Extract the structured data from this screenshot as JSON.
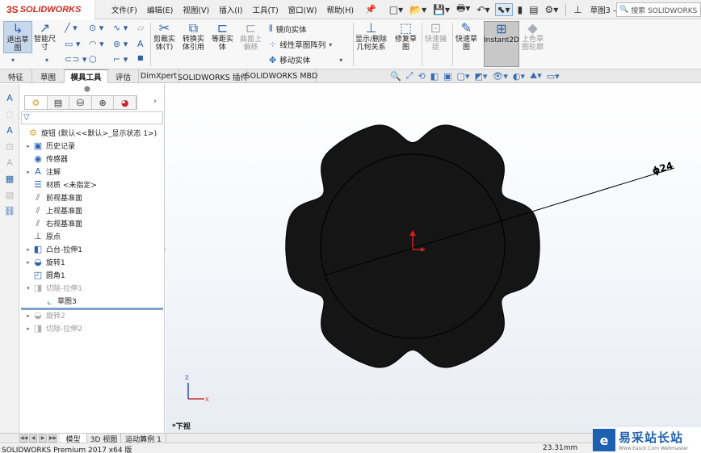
{
  "app": {
    "logo_ds": "3S",
    "logo_name": "SOLIDWORKS",
    "doc_title": "草图3 – 旋..."
  },
  "menu": [
    "文件(F)",
    "编辑(E)",
    "视图(V)",
    "插入(I)",
    "工具(T)",
    "窗口(W)",
    "帮助(H)"
  ],
  "search": {
    "label": "搜索 SOLIDWORKS 帮"
  },
  "ribbon": {
    "exit_sketch": "退出草\n图",
    "smart_dim": "智能尺\n寸",
    "trim": "剪裁实\n体(T)",
    "convert": "转换实\n体引用",
    "offset": "等距实\n体",
    "surface_offset": "曲面上\n偏移",
    "mirror": "镜向实体",
    "linear_pattern": "线性草图阵列",
    "move": "移动实体",
    "show_relations": "显示/删除\n几何关系",
    "repair": "修复草\n图",
    "quick_snap": "快速捕\n捉",
    "rapid_sketch": "快速草\n图",
    "instant2d": "Instant2D",
    "shaded_contour": "上色草\n图轮廓"
  },
  "tabs": [
    "特征",
    "草图",
    "模具工具",
    "评估",
    "DimXpert",
    "SOLIDWORKS 插件",
    "SOLIDWORKS MBD"
  ],
  "active_tab": "草图",
  "tree": {
    "root": "旋钮 (默认<<默认>_显示状态 1>)",
    "items": [
      {
        "label": "历史记录",
        "icon": "history-icon",
        "expand": "▸"
      },
      {
        "label": "传感器",
        "icon": "sensor-icon",
        "expand": ""
      },
      {
        "label": "注解",
        "icon": "annotation-icon",
        "expand": "▸"
      },
      {
        "label": "材质 <未指定>",
        "icon": "material-icon",
        "expand": ""
      },
      {
        "label": "前视基准面",
        "icon": "plane-icon",
        "expand": ""
      },
      {
        "label": "上视基准面",
        "icon": "plane-icon",
        "expand": ""
      },
      {
        "label": "右视基准面",
        "icon": "plane-icon",
        "expand": ""
      },
      {
        "label": "原点",
        "icon": "origin-icon",
        "expand": ""
      },
      {
        "label": "凸台-拉伸1",
        "icon": "extrude-icon",
        "expand": "▸"
      },
      {
        "label": "旋转1",
        "icon": "revolve-icon",
        "expand": "▸"
      },
      {
        "label": "圆角1",
        "icon": "fillet-icon",
        "expand": ""
      },
      {
        "label": "切除-拉伸1",
        "icon": "cut-extrude-icon",
        "expand": "▾"
      },
      {
        "label": "草图3",
        "icon": "sketch-icon",
        "expand": ""
      },
      {
        "label": "旋转2",
        "icon": "revolve-icon",
        "expand": "▸"
      },
      {
        "label": "切除-拉伸2",
        "icon": "cut-extrude-icon",
        "expand": "▸"
      }
    ]
  },
  "viewport": {
    "dimension": "ϕ24",
    "view_label": "*下视",
    "axis_x": "X",
    "axis_z": "Z"
  },
  "bottom_tabs": [
    "模型",
    "3D 视图",
    "运动算例 1"
  ],
  "status": {
    "product": "SOLIDWORKS Premium 2017 x64 版",
    "units": "23.31mm"
  },
  "watermark": {
    "main": "易采站长站",
    "sub": "Www.Easck.Com Webmaster"
  },
  "colors": {
    "brand_red": "#d02a1e",
    "accent_blue": "#2b63b0",
    "part_fill": "#151515"
  }
}
